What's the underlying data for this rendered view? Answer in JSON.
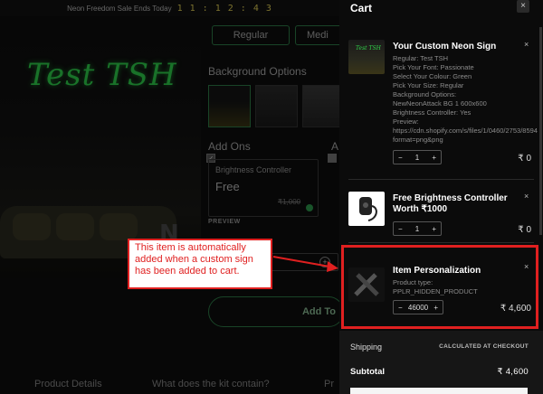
{
  "announcement": {
    "text": "Neon Freedom Sale Ends Today",
    "timer": "1 1 : 1 2 : 4 3"
  },
  "product": {
    "neon_text": "Test TSH",
    "sizes": [
      "Regular",
      "Medi"
    ],
    "background_heading": "Background Options",
    "addons_heading": "Add Ons",
    "addons_heading_2": "A",
    "addon": {
      "name": "Brightness Controller",
      "price": "Free",
      "strike_price": "₹1,000"
    },
    "preview_label": "PREVIEW",
    "add_to_cart_label": "Add To",
    "qty_plus": "+"
  },
  "bottom_tabs": [
    "Product Details",
    "What does the kit contain?",
    "Pr"
  ],
  "annotation": {
    "callout_text": "This item is automatically added when a custom sign has been added to cart."
  },
  "cart": {
    "title": "Cart",
    "close_glyph": "×",
    "items": [
      {
        "title": "Your Custom Neon Sign",
        "thumb_text": "Test TSH",
        "meta": [
          "Regular: Test TSH",
          "Pick Your Font: Passionate",
          "Select Your Colour: Green",
          "Pick Your Size: Regular",
          "Background Options:",
          "NewNeonAttack BG 1 600x600",
          "Brightness Controller: Yes",
          "Preview:",
          "https://cdn.shopify.com/s/files/1/0460/2753/8594",
          "format=png&png"
        ],
        "qty": "1",
        "price": "₹ 0"
      },
      {
        "title": "Free Brightness Controller Worth ₹1000",
        "meta": [],
        "qty": "1",
        "price": "₹ 0"
      },
      {
        "title": "Item Personalization",
        "meta": [
          "Product type:",
          "PPLR_HIDDEN_PRODUCT"
        ],
        "qty": "46000",
        "price": "₹ 4,600"
      }
    ],
    "stepper_minus": "−",
    "stepper_plus": "+",
    "item_close": "×",
    "shipping_label": "Shipping",
    "shipping_value": "CALCULATED AT CHECKOUT",
    "subtotal_label": "Subtotal",
    "subtotal_value": "₹ 4,600"
  },
  "colors": {
    "neon_green": "#2fd04b",
    "annotation_red": "#e02020",
    "cart_bg": "#0b0b0b"
  }
}
